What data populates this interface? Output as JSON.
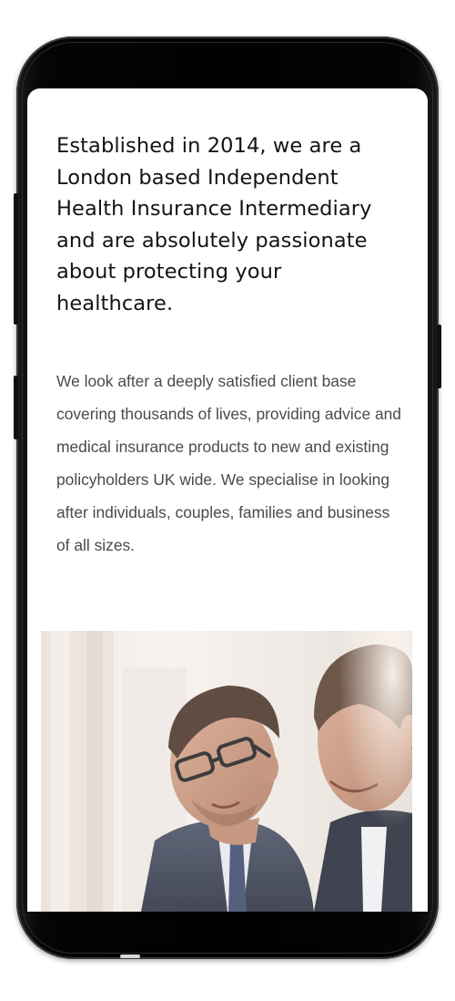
{
  "content": {
    "headline": "Established in 2014, we are a London based Independent Health Insurance Intermediary and are absolutely passionate about protecting your healthcare.",
    "body": "We look after a deeply satisfied client base covering thousands of lives, providing advice and medical insurance products to new and existing policyholders UK wide. We specialise in looking after individuals, couples, families and business of all sizes."
  },
  "colors": {
    "frame": "#000000",
    "screen_background": "#ffffff",
    "headline_text": "#141414",
    "body_text": "#4a4a4a"
  },
  "icons": {
    "front_camera": "camera-lens-icon",
    "proximity_sensor": "sensor-dot-icon",
    "earpiece": "speaker-grille-icon"
  }
}
